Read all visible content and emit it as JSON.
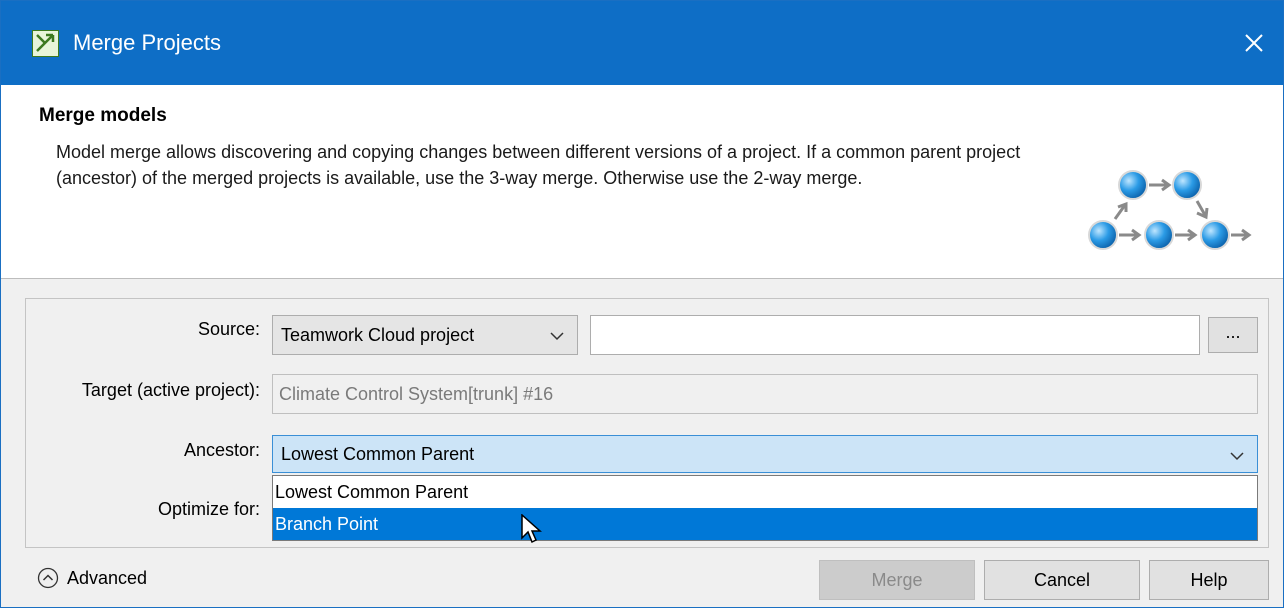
{
  "window": {
    "title": "Merge Projects"
  },
  "header": {
    "title": "Merge models",
    "description": "Model merge allows discovering and copying changes between different versions of a project. If a common parent project (ancestor) of the merged projects is available, use the 3-way merge. Otherwise use the 2-way merge."
  },
  "form": {
    "source_label": "Source:",
    "source_type": "Teamwork Cloud project",
    "source_value": "",
    "browse_label": "...",
    "target_label": "Target (active project):",
    "target_value": "Climate Control System[trunk] #16",
    "ancestor_label": "Ancestor:",
    "ancestor_selected": "Lowest Common Parent",
    "ancestor_options": [
      "Lowest Common Parent",
      "Branch Point"
    ],
    "highlighted_option": "Branch Point",
    "optimize_label": "Optimize for:"
  },
  "footer": {
    "advanced_label": "Advanced",
    "merge_label": "Merge",
    "cancel_label": "Cancel",
    "help_label": "Help"
  },
  "colors": {
    "titlebar": "#0e6ec6",
    "selection": "#0078d7",
    "focused_combo": "#cce4f7"
  },
  "icons": {
    "app": "merge-app-icon",
    "close": "close-icon",
    "chevron": "chevron-down-icon",
    "advanced": "chevron-up-circle-icon",
    "graphic": "merge-flow-graphic",
    "cursor": "mouse-pointer-icon"
  }
}
